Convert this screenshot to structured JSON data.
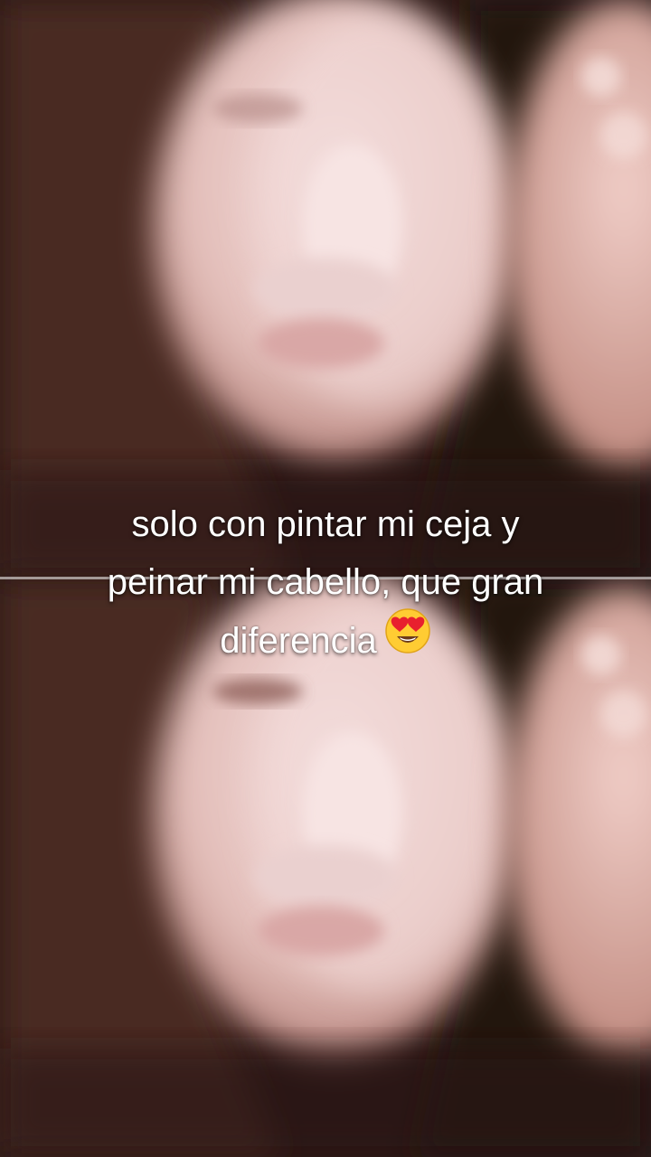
{
  "caption": {
    "line1": "solo con pintar mi ceja y",
    "line2": "peinar mi cabello, que gran",
    "line3": "diferencia"
  },
  "icons": {
    "caption_emoji": "heart-eyes-emoji-icon"
  },
  "colors": {
    "background": "#2a1714",
    "skin": "#e8c6c3",
    "hair": "#3a1f1a",
    "caption_text": "#ffffff",
    "emoji_face": "#ffcc33",
    "emoji_heart": "#e8202e"
  }
}
